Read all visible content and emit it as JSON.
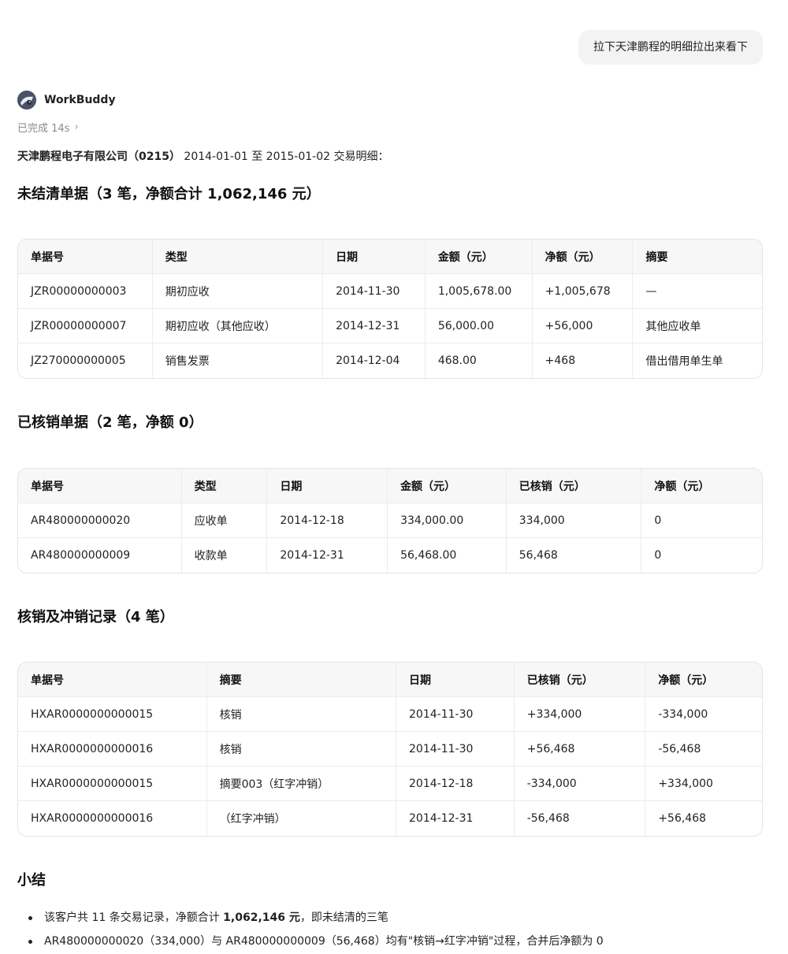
{
  "user_message": "拉下天津鹏程的明细拉出来看下",
  "assistant": {
    "name": "WorkBuddy",
    "status": "已完成 14s"
  },
  "intro": {
    "company": "天津鹏程电子有限公司（0215）",
    "rest": " 2014-01-01 至 2015-01-02 交易明细："
  },
  "section1": {
    "title": "未结清单据（3 笔，净额合计 1,062,146 元）",
    "headers": [
      "单据号",
      "类型",
      "日期",
      "金额（元）",
      "净额（元）",
      "摘要"
    ],
    "rows": [
      [
        "JZR00000000003",
        "期初应收",
        "2014-11-30",
        "1,005,678.00",
        "+1,005,678",
        "—"
      ],
      [
        "JZR00000000007",
        "期初应收（其他应收）",
        "2014-12-31",
        "56,000.00",
        "+56,000",
        "其他应收单"
      ],
      [
        "JZ270000000005",
        "销售发票",
        "2014-12-04",
        "468.00",
        "+468",
        "借出借用单生单"
      ]
    ]
  },
  "section2": {
    "title": "已核销单据（2 笔，净额 0）",
    "headers": [
      "单据号",
      "类型",
      "日期",
      "金额（元）",
      "已核销（元）",
      "净额（元）"
    ],
    "rows": [
      [
        "AR480000000020",
        "应收单",
        "2014-12-18",
        "334,000.00",
        "334,000",
        "0"
      ],
      [
        "AR480000000009",
        "收款单",
        "2014-12-31",
        "56,468.00",
        "56,468",
        "0"
      ]
    ]
  },
  "section3": {
    "title": "核销及冲销记录（4 笔）",
    "headers": [
      "单据号",
      "摘要",
      "日期",
      "已核销（元）",
      "净额（元）"
    ],
    "rows": [
      [
        "HXAR0000000000015",
        "核销",
        "2014-11-30",
        "+334,000",
        "-334,000"
      ],
      [
        "HXAR0000000000016",
        "核销",
        "2014-11-30",
        "+56,468",
        "-56,468"
      ],
      [
        "HXAR0000000000015",
        "摘要003（红字冲销）",
        "2014-12-18",
        "-334,000",
        "+334,000"
      ],
      [
        "HXAR0000000000016",
        "（红字冲销）",
        "2014-12-31",
        "-56,468",
        "+56,468"
      ]
    ]
  },
  "summary": {
    "title": "小结",
    "items": [
      {
        "pre": "该客户共 11 条交易记录，净额合计 ",
        "bold": "1,062,146 元",
        "post": "，即未结清的三笔"
      },
      {
        "pre": "AR480000000020（334,000）与 AR480000000009（56,468）均有\"核销→红字冲销\"过程，合并后净额为 0",
        "bold": "",
        "post": ""
      }
    ]
  }
}
